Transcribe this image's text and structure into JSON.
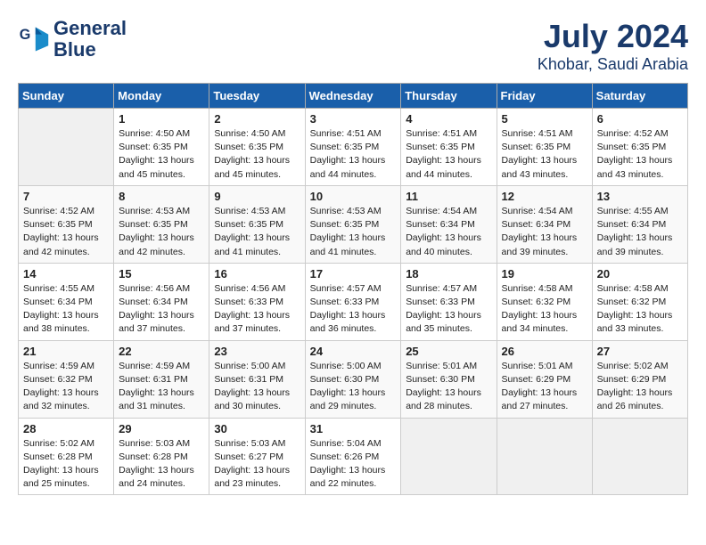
{
  "logo": {
    "line1": "General",
    "line2": "Blue"
  },
  "title": "July 2024",
  "subtitle": "Khobar, Saudi Arabia",
  "days_header": [
    "Sunday",
    "Monday",
    "Tuesday",
    "Wednesday",
    "Thursday",
    "Friday",
    "Saturday"
  ],
  "weeks": [
    [
      {
        "day": "",
        "info": ""
      },
      {
        "day": "1",
        "info": "Sunrise: 4:50 AM\nSunset: 6:35 PM\nDaylight: 13 hours\nand 45 minutes."
      },
      {
        "day": "2",
        "info": "Sunrise: 4:50 AM\nSunset: 6:35 PM\nDaylight: 13 hours\nand 45 minutes."
      },
      {
        "day": "3",
        "info": "Sunrise: 4:51 AM\nSunset: 6:35 PM\nDaylight: 13 hours\nand 44 minutes."
      },
      {
        "day": "4",
        "info": "Sunrise: 4:51 AM\nSunset: 6:35 PM\nDaylight: 13 hours\nand 44 minutes."
      },
      {
        "day": "5",
        "info": "Sunrise: 4:51 AM\nSunset: 6:35 PM\nDaylight: 13 hours\nand 43 minutes."
      },
      {
        "day": "6",
        "info": "Sunrise: 4:52 AM\nSunset: 6:35 PM\nDaylight: 13 hours\nand 43 minutes."
      }
    ],
    [
      {
        "day": "7",
        "info": "Sunrise: 4:52 AM\nSunset: 6:35 PM\nDaylight: 13 hours\nand 42 minutes."
      },
      {
        "day": "8",
        "info": "Sunrise: 4:53 AM\nSunset: 6:35 PM\nDaylight: 13 hours\nand 42 minutes."
      },
      {
        "day": "9",
        "info": "Sunrise: 4:53 AM\nSunset: 6:35 PM\nDaylight: 13 hours\nand 41 minutes."
      },
      {
        "day": "10",
        "info": "Sunrise: 4:53 AM\nSunset: 6:35 PM\nDaylight: 13 hours\nand 41 minutes."
      },
      {
        "day": "11",
        "info": "Sunrise: 4:54 AM\nSunset: 6:34 PM\nDaylight: 13 hours\nand 40 minutes."
      },
      {
        "day": "12",
        "info": "Sunrise: 4:54 AM\nSunset: 6:34 PM\nDaylight: 13 hours\nand 39 minutes."
      },
      {
        "day": "13",
        "info": "Sunrise: 4:55 AM\nSunset: 6:34 PM\nDaylight: 13 hours\nand 39 minutes."
      }
    ],
    [
      {
        "day": "14",
        "info": "Sunrise: 4:55 AM\nSunset: 6:34 PM\nDaylight: 13 hours\nand 38 minutes."
      },
      {
        "day": "15",
        "info": "Sunrise: 4:56 AM\nSunset: 6:34 PM\nDaylight: 13 hours\nand 37 minutes."
      },
      {
        "day": "16",
        "info": "Sunrise: 4:56 AM\nSunset: 6:33 PM\nDaylight: 13 hours\nand 37 minutes."
      },
      {
        "day": "17",
        "info": "Sunrise: 4:57 AM\nSunset: 6:33 PM\nDaylight: 13 hours\nand 36 minutes."
      },
      {
        "day": "18",
        "info": "Sunrise: 4:57 AM\nSunset: 6:33 PM\nDaylight: 13 hours\nand 35 minutes."
      },
      {
        "day": "19",
        "info": "Sunrise: 4:58 AM\nSunset: 6:32 PM\nDaylight: 13 hours\nand 34 minutes."
      },
      {
        "day": "20",
        "info": "Sunrise: 4:58 AM\nSunset: 6:32 PM\nDaylight: 13 hours\nand 33 minutes."
      }
    ],
    [
      {
        "day": "21",
        "info": "Sunrise: 4:59 AM\nSunset: 6:32 PM\nDaylight: 13 hours\nand 32 minutes."
      },
      {
        "day": "22",
        "info": "Sunrise: 4:59 AM\nSunset: 6:31 PM\nDaylight: 13 hours\nand 31 minutes."
      },
      {
        "day": "23",
        "info": "Sunrise: 5:00 AM\nSunset: 6:31 PM\nDaylight: 13 hours\nand 30 minutes."
      },
      {
        "day": "24",
        "info": "Sunrise: 5:00 AM\nSunset: 6:30 PM\nDaylight: 13 hours\nand 29 minutes."
      },
      {
        "day": "25",
        "info": "Sunrise: 5:01 AM\nSunset: 6:30 PM\nDaylight: 13 hours\nand 28 minutes."
      },
      {
        "day": "26",
        "info": "Sunrise: 5:01 AM\nSunset: 6:29 PM\nDaylight: 13 hours\nand 27 minutes."
      },
      {
        "day": "27",
        "info": "Sunrise: 5:02 AM\nSunset: 6:29 PM\nDaylight: 13 hours\nand 26 minutes."
      }
    ],
    [
      {
        "day": "28",
        "info": "Sunrise: 5:02 AM\nSunset: 6:28 PM\nDaylight: 13 hours\nand 25 minutes."
      },
      {
        "day": "29",
        "info": "Sunrise: 5:03 AM\nSunset: 6:28 PM\nDaylight: 13 hours\nand 24 minutes."
      },
      {
        "day": "30",
        "info": "Sunrise: 5:03 AM\nSunset: 6:27 PM\nDaylight: 13 hours\nand 23 minutes."
      },
      {
        "day": "31",
        "info": "Sunrise: 5:04 AM\nSunset: 6:26 PM\nDaylight: 13 hours\nand 22 minutes."
      },
      {
        "day": "",
        "info": ""
      },
      {
        "day": "",
        "info": ""
      },
      {
        "day": "",
        "info": ""
      }
    ]
  ]
}
